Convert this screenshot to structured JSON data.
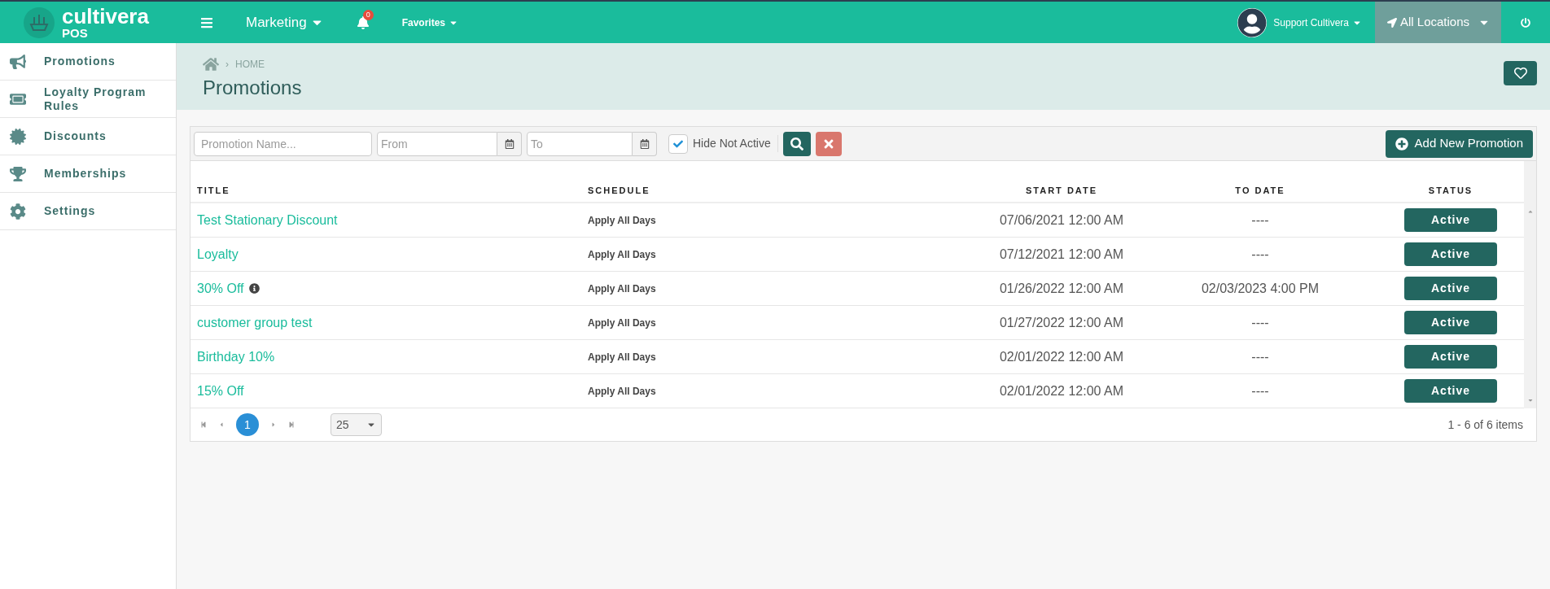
{
  "brand": {
    "name": "cultivera",
    "sub": "POS"
  },
  "topbar": {
    "module": "Marketing",
    "notifications": "0",
    "favorites": "Favorites",
    "user": "Support Cultivera",
    "location": "All Locations"
  },
  "sidebar": {
    "items": [
      {
        "label": "Promotions"
      },
      {
        "label": "Loyalty Program Rules"
      },
      {
        "label": "Discounts"
      },
      {
        "label": "Memberships"
      },
      {
        "label": "Settings"
      }
    ]
  },
  "breadcrumb": {
    "separator": "›",
    "label": "HOME"
  },
  "page_title": "Promotions",
  "filters": {
    "name_placeholder": "Promotion Name...",
    "from_placeholder": "From",
    "to_placeholder": "To",
    "hide_not_active": {
      "label": "Hide Not Active",
      "checked": true
    },
    "add_button": "Add New Promotion"
  },
  "table": {
    "columns": [
      "TITLE",
      "SCHEDULE",
      "START DATE",
      "TO DATE",
      "STATUS"
    ],
    "rows": [
      {
        "title": "Test Stationary Discount",
        "info": false,
        "schedule": "Apply All Days",
        "start": "07/06/2021 12:00 AM",
        "to": "----",
        "status": "Active"
      },
      {
        "title": "Loyalty",
        "info": false,
        "schedule": "Apply All Days",
        "start": "07/12/2021 12:00 AM",
        "to": "----",
        "status": "Active"
      },
      {
        "title": "30% Off",
        "info": true,
        "schedule": "Apply All Days",
        "start": "01/26/2022 12:00 AM",
        "to": "02/03/2023 4:00 PM",
        "status": "Active"
      },
      {
        "title": "customer group test",
        "info": false,
        "schedule": "Apply All Days",
        "start": "01/27/2022 12:00 AM",
        "to": "----",
        "status": "Active"
      },
      {
        "title": "Birthday 10%",
        "info": false,
        "schedule": "Apply All Days",
        "start": "02/01/2022 12:00 AM",
        "to": "----",
        "status": "Active"
      },
      {
        "title": "15% Off",
        "info": false,
        "schedule": "Apply All Days",
        "start": "02/01/2022 12:00 AM",
        "to": "----",
        "status": "Active"
      }
    ]
  },
  "pager": {
    "pages": [
      {
        "label": "1",
        "selected": true
      }
    ],
    "page_size": "25",
    "summary": "1 - 6 of 6 items"
  }
}
